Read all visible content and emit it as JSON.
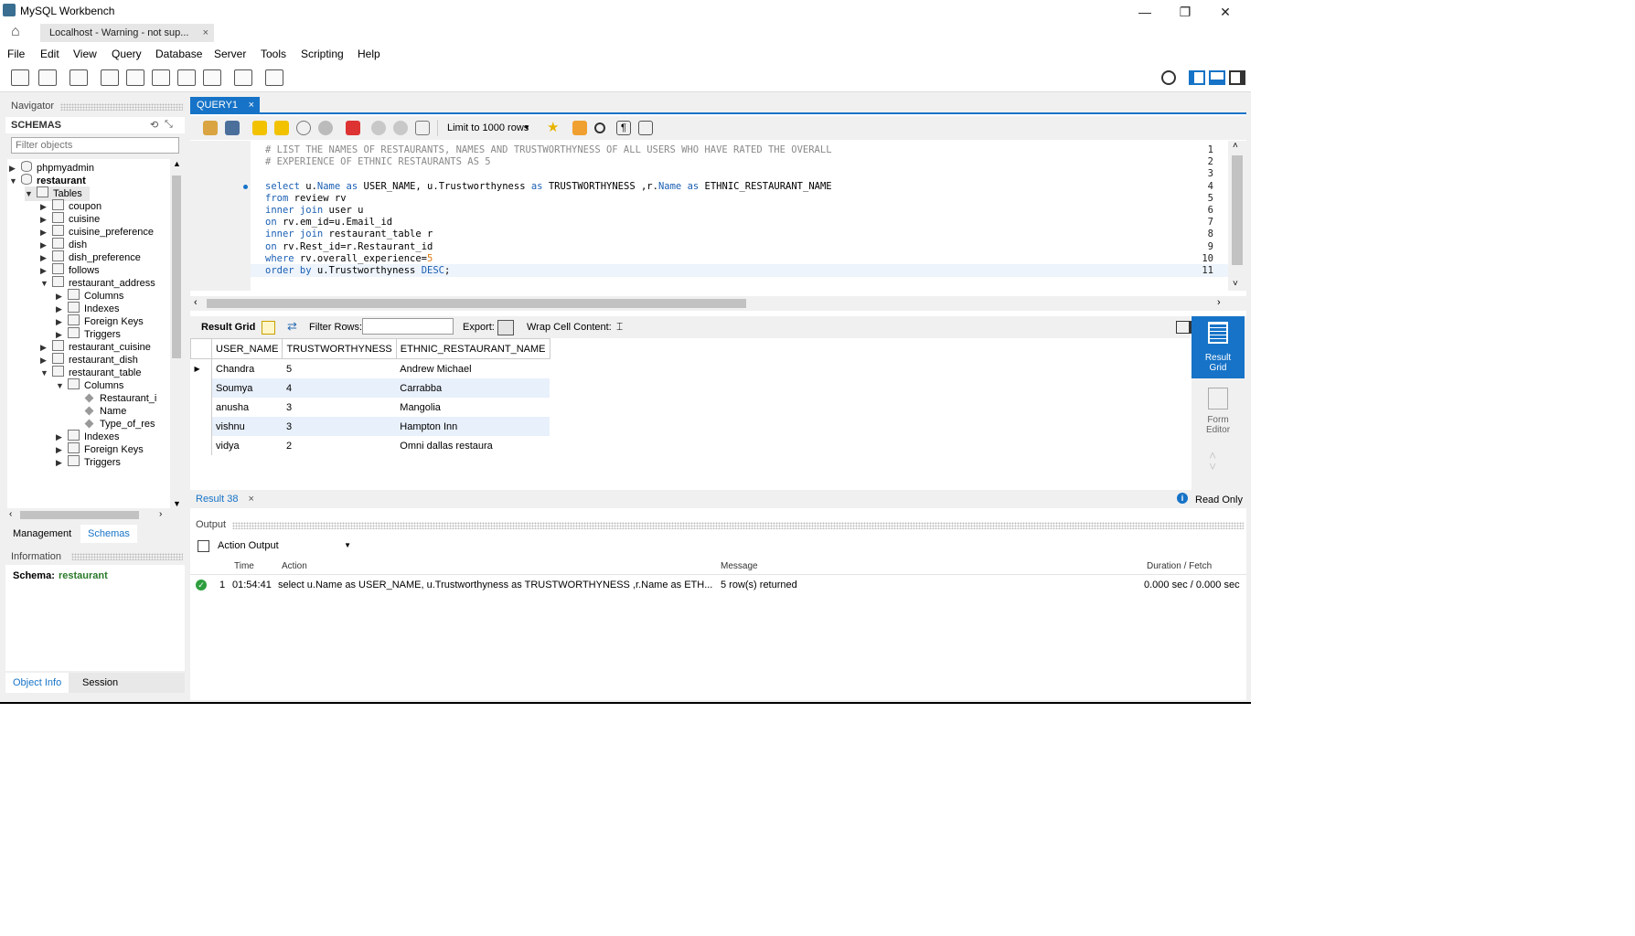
{
  "window": {
    "title": "MySQL Workbench",
    "connection_tab": "Localhost - Warning - not sup...",
    "minimize": "—",
    "maximize": "❐",
    "close": "✕"
  },
  "menu": [
    "File",
    "Edit",
    "View",
    "Query",
    "Database",
    "Server",
    "Tools",
    "Scripting",
    "Help"
  ],
  "navigator": {
    "header": "Navigator",
    "schemas_label": "SCHEMAS",
    "filter_placeholder": "Filter objects",
    "tree": [
      {
        "label": "phpmyadmin",
        "indent": 0,
        "twisty": "▶",
        "icon": "db",
        "bold": false
      },
      {
        "label": "restaurant",
        "indent": 0,
        "twisty": "▼",
        "icon": "db",
        "bold": true
      },
      {
        "label": "Tables",
        "indent": 1,
        "twisty": "▼",
        "icon": "folder",
        "bold": false,
        "selected": true
      },
      {
        "label": "coupon",
        "indent": 2,
        "twisty": "▶",
        "icon": "table"
      },
      {
        "label": "cuisine",
        "indent": 2,
        "twisty": "▶",
        "icon": "table"
      },
      {
        "label": "cuisine_preference",
        "indent": 2,
        "twisty": "▶",
        "icon": "table"
      },
      {
        "label": "dish",
        "indent": 2,
        "twisty": "▶",
        "icon": "table"
      },
      {
        "label": "dish_preference",
        "indent": 2,
        "twisty": "▶",
        "icon": "table"
      },
      {
        "label": "follows",
        "indent": 2,
        "twisty": "▶",
        "icon": "table"
      },
      {
        "label": "restaurant_address",
        "indent": 2,
        "twisty": "▼",
        "icon": "table"
      },
      {
        "label": "Columns",
        "indent": 3,
        "twisty": "▶",
        "icon": "folder"
      },
      {
        "label": "Indexes",
        "indent": 3,
        "twisty": "▶",
        "icon": "folder"
      },
      {
        "label": "Foreign Keys",
        "indent": 3,
        "twisty": "▶",
        "icon": "folder"
      },
      {
        "label": "Triggers",
        "indent": 3,
        "twisty": "▶",
        "icon": "folder"
      },
      {
        "label": "restaurant_cuisine",
        "indent": 2,
        "twisty": "▶",
        "icon": "table"
      },
      {
        "label": "restaurant_dish",
        "indent": 2,
        "twisty": "▶",
        "icon": "table"
      },
      {
        "label": "restaurant_table",
        "indent": 2,
        "twisty": "▼",
        "icon": "table"
      },
      {
        "label": "Columns",
        "indent": 3,
        "twisty": "▼",
        "icon": "folder"
      },
      {
        "label": "Restaurant_i",
        "indent": 4,
        "twisty": "",
        "icon": "column"
      },
      {
        "label": "Name",
        "indent": 4,
        "twisty": "",
        "icon": "column"
      },
      {
        "label": "Type_of_res",
        "indent": 4,
        "twisty": "",
        "icon": "column"
      },
      {
        "label": "Indexes",
        "indent": 3,
        "twisty": "▶",
        "icon": "folder"
      },
      {
        "label": "Foreign Keys",
        "indent": 3,
        "twisty": "▶",
        "icon": "folder"
      },
      {
        "label": "Triggers",
        "indent": 3,
        "twisty": "▶",
        "icon": "folder"
      }
    ],
    "tab_management": "Management",
    "tab_schemas": "Schemas"
  },
  "information": {
    "header": "Information",
    "schema_label": "Schema:",
    "schema_value": "restaurant",
    "tab_object_info": "Object Info",
    "tab_session": "Session"
  },
  "editor": {
    "tab_label": "QUERY1",
    "limit_label": "Limit to 1000 rows",
    "lines": [
      {
        "n": "1",
        "html": "<span class='cm'># LIST THE NAMES OF RESTAURANTS, NAMES AND TRUSTWORTHYNESS OF ALL USERS WHO HAVE RATED THE OVERALL</span>"
      },
      {
        "n": "2",
        "html": "<span class='cm'># EXPERIENCE OF ETHNIC RESTAURANTS AS 5</span>"
      },
      {
        "n": "3",
        "html": ""
      },
      {
        "n": "4",
        "html": "<span class='kw'>select</span> u.<span class='kw'>Name</span> <span class='kw'>as</span> USER_NAME, u.Trustworthyness <span class='kw'>as</span> TRUSTWORTHYNESS ,r.<span class='kw'>Name</span> <span class='kw'>as</span> ETHNIC_RESTAURANT_NAME"
      },
      {
        "n": "5",
        "html": "<span class='kw'>from</span> review rv"
      },
      {
        "n": "6",
        "html": "<span class='kw'>inner join</span> user u"
      },
      {
        "n": "7",
        "html": "<span class='kw'>on</span> rv.em_id=u.Email_id"
      },
      {
        "n": "8",
        "html": "<span class='kw'>inner join</span> restaurant_table r"
      },
      {
        "n": "9",
        "html": "<span class='kw'>on</span> rv.Rest_id=r.Restaurant_id"
      },
      {
        "n": "10",
        "html": "<span class='kw'>where</span> rv.overall_experience=<span class='num'>5</span>"
      },
      {
        "n": "11",
        "html": "<span class='kw'>order by</span> u.Trustworthyness <span class='kw'>DESC</span>;"
      }
    ]
  },
  "result": {
    "result_grid_label": "Result Grid",
    "filter_rows_label": "Filter Rows:",
    "export_label": "Export:",
    "wrap_label": "Wrap Cell Content:",
    "columns": [
      "USER_NAME",
      "TRUSTWORTHYNESS",
      "ETHNIC_RESTAURANT_NAME"
    ],
    "rows": [
      [
        "Chandra",
        "5",
        "Andrew Michael"
      ],
      [
        "Soumya",
        "4",
        "Carrabba"
      ],
      [
        "anusha",
        "3",
        "Mangolia"
      ],
      [
        "vishnu",
        "3",
        "Hampton Inn"
      ],
      [
        "vidya",
        "2",
        "Omni dallas restaura"
      ]
    ],
    "side_result_grid": "Result Grid",
    "side_form_editor": "Form Editor",
    "result_tab": "Result 38",
    "read_only": "Read Only"
  },
  "output": {
    "header": "Output",
    "selector": "Action Output",
    "columns": [
      "Time",
      "Action",
      "Message",
      "Duration / Fetch"
    ],
    "rows": [
      {
        "n": "1",
        "time": "01:54:41",
        "action": "select u.Name as USER_NAME, u.Trustworthyness as TRUSTWORTHYNESS ,r.Name as ETH...",
        "message": "5 row(s) returned",
        "duration": "0.000 sec / 0.000 sec"
      }
    ]
  },
  "colors": {
    "accent": "#1673c7",
    "success": "#2e9e3e"
  }
}
